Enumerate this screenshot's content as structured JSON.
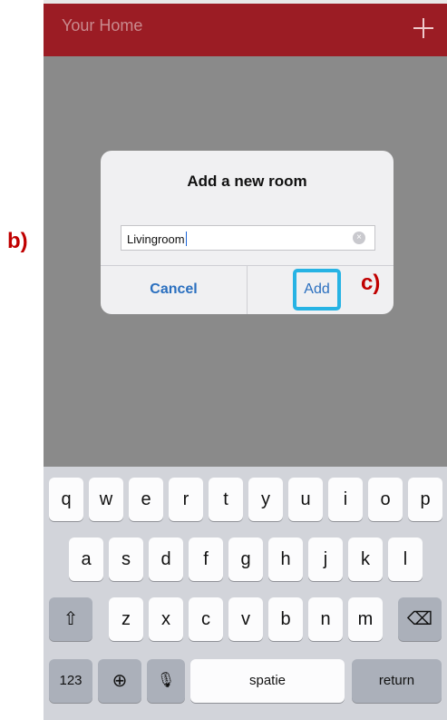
{
  "header": {
    "title": "Your Home",
    "add_icon": "plus-icon"
  },
  "dialog": {
    "title": "Add a new room",
    "input_value": "Livingroom",
    "cancel_label": "Cancel",
    "add_label": "Add"
  },
  "annotations": {
    "b": "b)",
    "c": "c)"
  },
  "keyboard": {
    "row1": [
      "q",
      "w",
      "e",
      "r",
      "t",
      "y",
      "u",
      "i",
      "o",
      "p"
    ],
    "row2": [
      "a",
      "s",
      "d",
      "f",
      "g",
      "h",
      "j",
      "k",
      "l"
    ],
    "row3": [
      "z",
      "x",
      "c",
      "v",
      "b",
      "n",
      "m"
    ],
    "numbers_label": "123",
    "space_label": "spatie",
    "return_label": "return",
    "shift_icon": "shift-icon",
    "backspace_icon": "backspace-icon",
    "globe_icon": "globe-icon",
    "mic_icon": "microphone-icon"
  },
  "colors": {
    "header_bg": "#9b1c24",
    "overlay": "#8a8a8a",
    "accent_blue": "#2a6fbf",
    "highlight": "#27b3e4",
    "annotation_red": "#c00000"
  }
}
